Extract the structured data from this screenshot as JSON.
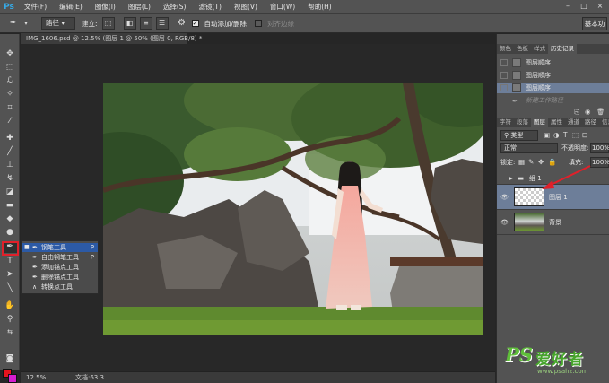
{
  "app": {
    "logo": "Ps"
  },
  "menu": [
    "文件(F)",
    "编辑(E)",
    "图像(I)",
    "图层(L)",
    "选择(S)",
    "滤镜(T)",
    "视图(V)",
    "窗口(W)",
    "帮助(H)"
  ],
  "window_controls": {
    "minimize": "–",
    "restore": "□",
    "close": "×"
  },
  "options_bar": {
    "tool_icon": "pen-icon",
    "mode_select": "路径",
    "build_label": "建立:",
    "auto_add_delete": "自动添加/删除",
    "align_edges": "对齐边缘",
    "workspace": "基本功"
  },
  "document": {
    "tab_title": "IMG_1606.psd @ 12.5% (图层 1 @ 50% (图层 0, RGB/8) *",
    "zoom": "12.5%",
    "doc_info": "文档:63.3"
  },
  "tool_flyout": {
    "items": [
      {
        "icon": "pen-icon",
        "label": "钢笔工具",
        "key": "P",
        "selected": true
      },
      {
        "icon": "freeform-pen-icon",
        "label": "自由钢笔工具",
        "key": "P",
        "selected": false
      },
      {
        "icon": "add-anchor-icon",
        "label": "添加锚点工具",
        "key": "",
        "selected": false
      },
      {
        "icon": "delete-anchor-icon",
        "label": "删除锚点工具",
        "key": "",
        "selected": false
      },
      {
        "icon": "convert-point-icon",
        "label": "转换点工具",
        "key": "",
        "selected": false
      }
    ]
  },
  "colors": {
    "foreground": "#e6141e",
    "background": "#d61dd0",
    "highlight": "#e0202a",
    "selection": "#2c5aa6"
  },
  "history_panel": {
    "tabs": [
      "颜色",
      "色板",
      "样式",
      "历史记录"
    ],
    "active_tab": "历史记录",
    "items": [
      {
        "label": "图层顺序",
        "selected": false
      },
      {
        "label": "图层顺序",
        "selected": false
      },
      {
        "label": "图层顺序",
        "selected": true
      }
    ],
    "snapshot": "新建工作路径"
  },
  "layers_panel": {
    "tabs": [
      "字符",
      "段落",
      "图层",
      "属性",
      "通道",
      "路径",
      "信息"
    ],
    "active_tab": "图层",
    "filter": "类型",
    "blend_mode": "正常",
    "opacity_label": "不透明度:",
    "opacity": "100%",
    "lock_label": "锁定:",
    "fill_label": "填充:",
    "fill": "100%",
    "layers": [
      {
        "name": "组 1",
        "type": "group",
        "visible": false,
        "selected": false
      },
      {
        "name": "图层 1",
        "type": "layer",
        "visible": true,
        "selected": true
      },
      {
        "name": "背景",
        "type": "background",
        "visible": true,
        "selected": false
      }
    ]
  },
  "watermark": {
    "brand": "PS",
    "name": "爱好者",
    "url": "www.psahz.com"
  }
}
